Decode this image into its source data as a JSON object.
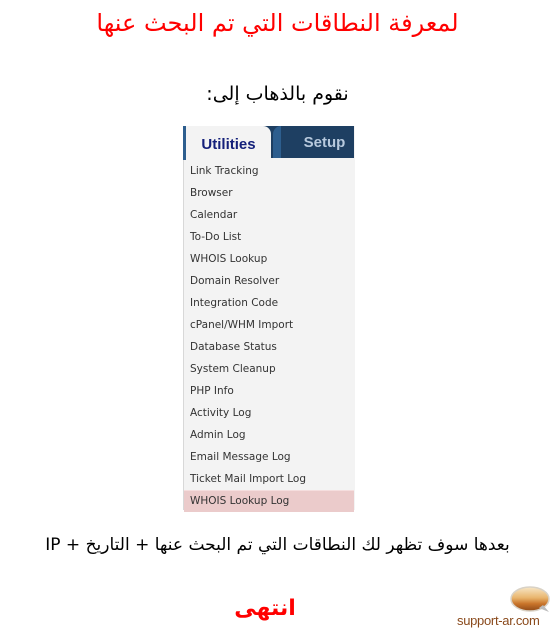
{
  "page": {
    "title": "لمعرفة النطاقات التي تم البحث عنها",
    "subtitle": "نقوم بالذهاب إلى:",
    "description": "بعدها سوف تظهر لك النطاقات التي تم البحث عنها + التاريخ + IP",
    "end_text": "انتهى"
  },
  "tabs": {
    "active": "Utilities",
    "inactive": "Setup"
  },
  "menu": {
    "items": [
      {
        "label": "Link Tracking"
      },
      {
        "label": "Browser"
      },
      {
        "label": "Calendar"
      },
      {
        "label": "To-Do List"
      },
      {
        "label": "WHOIS Lookup"
      },
      {
        "label": "Domain Resolver"
      },
      {
        "label": "Integration Code"
      },
      {
        "label": "cPanel/WHM Import"
      },
      {
        "label": "Database Status"
      },
      {
        "label": "System Cleanup"
      },
      {
        "label": "PHP Info"
      },
      {
        "label": "Activity Log"
      },
      {
        "label": "Admin Log"
      },
      {
        "label": "Email Message Log"
      },
      {
        "label": "Ticket Mail Import Log"
      },
      {
        "label": "WHOIS Lookup Log",
        "selected": true
      }
    ]
  },
  "logo": {
    "text": "support-ar.com",
    "icon": "speech-bubble-logo-icon"
  },
  "colors": {
    "title": "#ff0000",
    "tab_bar": "#1e3f62",
    "tab_active_text": "#14207a",
    "selected_item": "#ebcbcb"
  }
}
